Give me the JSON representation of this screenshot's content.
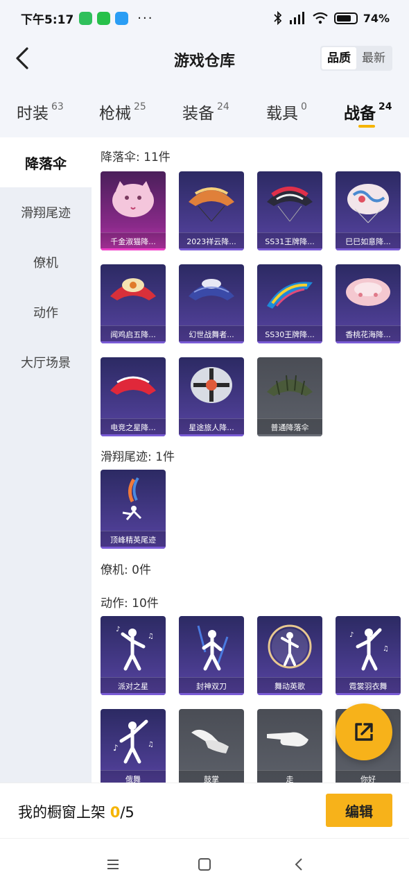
{
  "status_bar": {
    "time": "下午5:17",
    "dots": "···",
    "battery": "74%"
  },
  "header": {
    "title": "游戏仓库",
    "sort_options": [
      "品质",
      "最新"
    ]
  },
  "tabs": [
    {
      "label": "时装",
      "count": "63"
    },
    {
      "label": "枪械",
      "count": "25"
    },
    {
      "label": "装备",
      "count": "24"
    },
    {
      "label": "载具",
      "count": "0"
    },
    {
      "label": "战备",
      "count": "24"
    }
  ],
  "sidebar": [
    "降落伞",
    "滑翔尾迹",
    "僚机",
    "动作",
    "大厅场景"
  ],
  "sections": {
    "parachute": {
      "title": "降落伞: 11件",
      "items": [
        "千金淑猫降...",
        "2023祥云降...",
        "SS31王牌降...",
        "巳巳如意降...",
        "闻鸡启五降...",
        "幻世战舞者...",
        "SS30王牌降...",
        "香桃花海降...",
        "电竞之星降...",
        "星途旅人降...",
        "普通降落伞"
      ]
    },
    "trail": {
      "title": "滑翔尾迹: 1件",
      "items": [
        "顶峰精英尾迹"
      ]
    },
    "wingman": {
      "title": "僚机: 0件"
    },
    "emote": {
      "title": "动作: 10件",
      "items": [
        "派对之星",
        "封神双刀",
        "舞动英歌",
        "霓裳羽衣舞",
        "俄舞",
        "鼓掌",
        "走",
        "你好"
      ]
    }
  },
  "bottom": {
    "showcase_label": "我的橱窗上架 ",
    "current": "0",
    "total": "/5",
    "edit": "编辑"
  },
  "colors": {
    "accent": "#f7b21a",
    "card_purple": "#4a3c8f",
    "card_pink": "#c73ab6",
    "card_gray": "#5d616a"
  }
}
